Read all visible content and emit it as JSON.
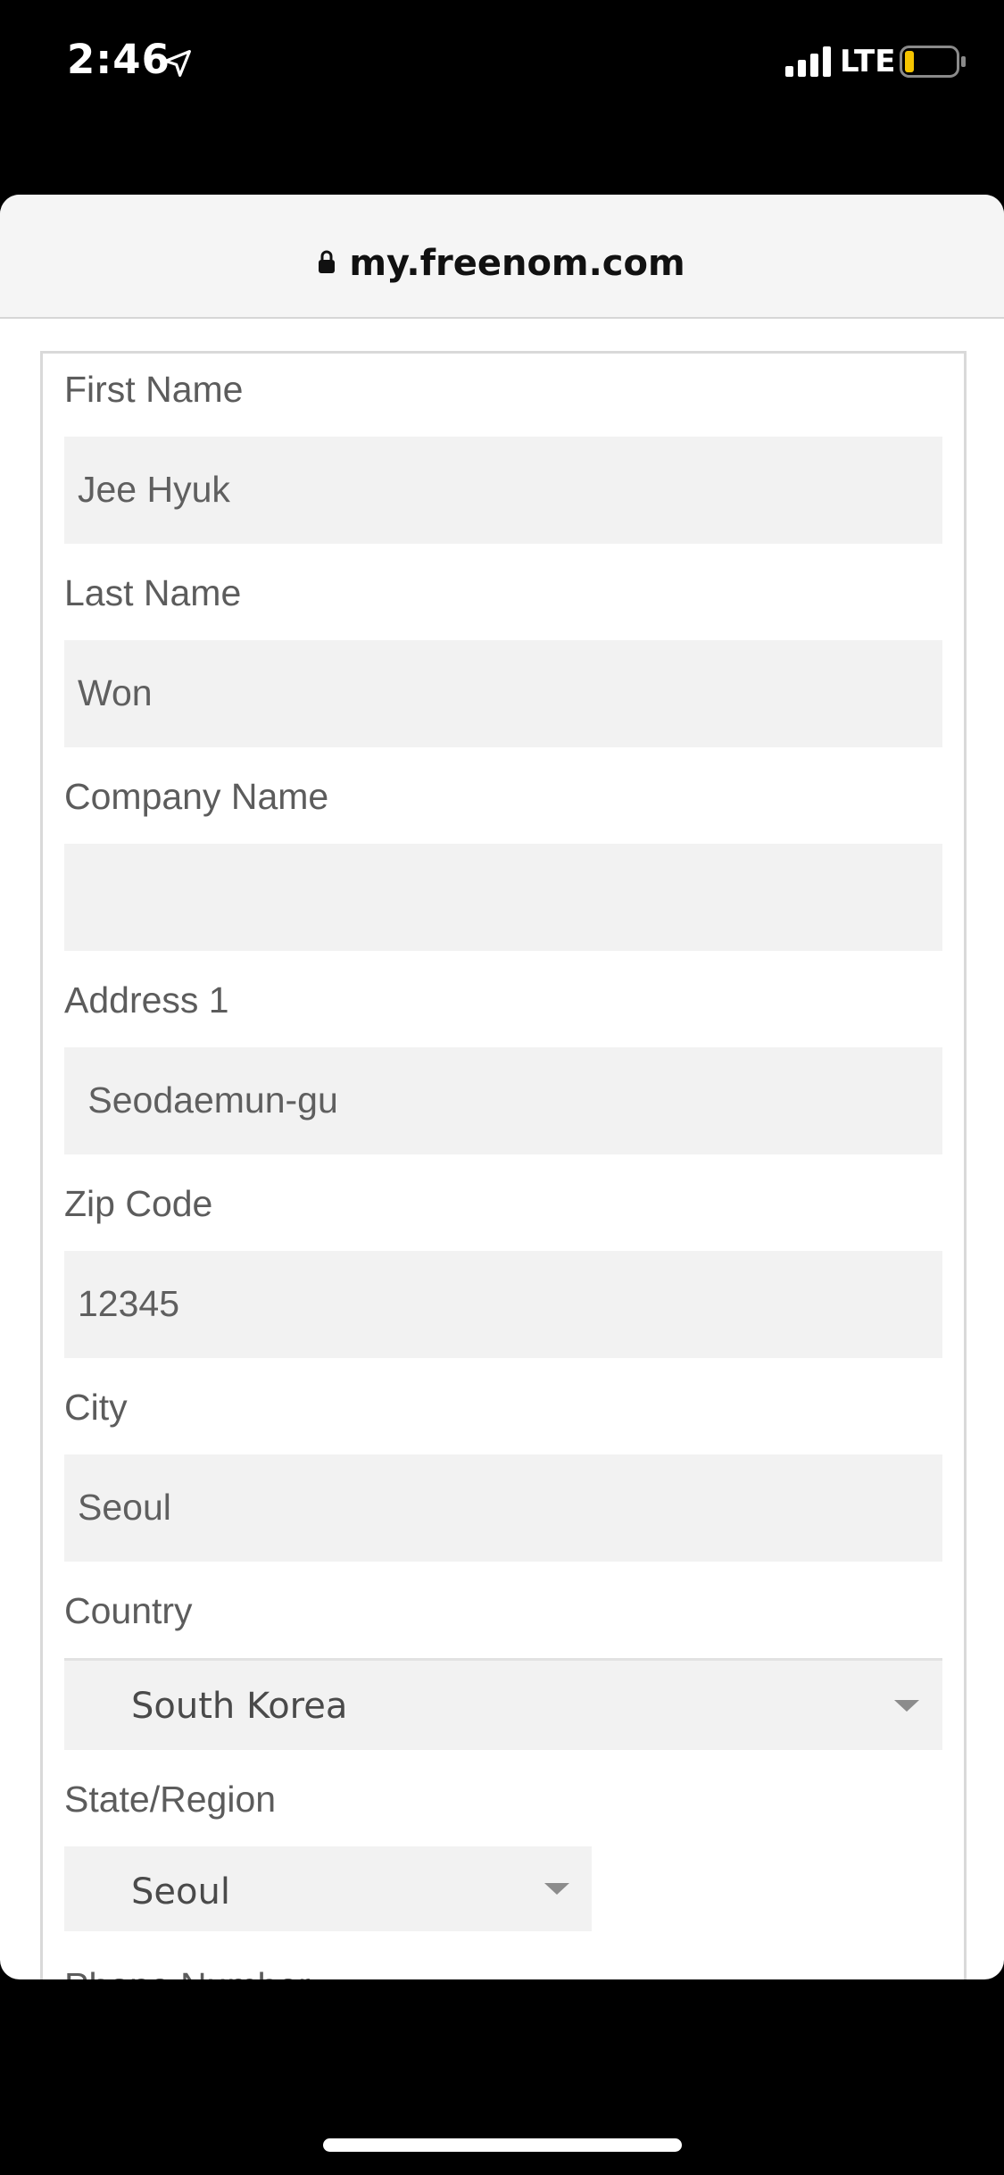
{
  "status_bar": {
    "time": "2:46",
    "network": "LTE",
    "battery_color": "#f5c400"
  },
  "browser": {
    "url": "my.freenom.com"
  },
  "form": {
    "first_name": {
      "label": "First Name",
      "value": "Jee Hyuk"
    },
    "last_name": {
      "label": "Last Name",
      "value": "Won"
    },
    "company_name": {
      "label": "Company Name",
      "value": ""
    },
    "address1": {
      "label": "Address 1",
      "value": " Seodaemun-gu"
    },
    "zip_code": {
      "label": "Zip Code",
      "value": "12345"
    },
    "city": {
      "label": "City",
      "value": "Seoul"
    },
    "country": {
      "label": "Country",
      "value": "South Korea"
    },
    "state": {
      "label": "State/Region",
      "value": "Seoul"
    },
    "phone": {
      "label": "Phone Number"
    }
  }
}
